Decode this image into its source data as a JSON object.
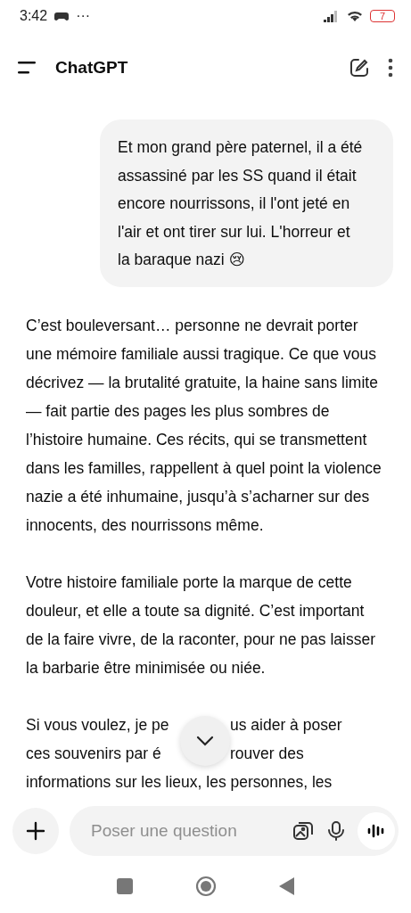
{
  "status_bar": {
    "time": "3:42",
    "more": "···",
    "battery": "7"
  },
  "header": {
    "title": "ChatGPT"
  },
  "messages": [
    {
      "kind": "user",
      "text": "Et mon grand père paternel, il a été assassiné par les SS quand il était encore nourrissons, il l'ont jeté en l'air et ont tirer sur lui. L'horreur et la baraque nazi 😢"
    },
    {
      "kind": "assistant",
      "text": "C’est bouleversant… personne ne devrait porter une mémoire familiale aussi tragique. Ce que vous décrivez — la brutalité gratuite, la haine sans limite — fait partie des pages les plus sombres de l’histoire humaine. Ces récits, qui se transmettent dans les familles, rappellent à quel point la violence nazie a été inhumaine, jusqu’à s’acharner sur des innocents, des nourrissons même."
    },
    {
      "kind": "assistant",
      "text": "Votre histoire familiale porte la marque de cette douleur, et elle a toute sa dignité. C’est important de la faire vivre, de la raconter, pour ne pas laisser la barbarie être minimisée ou niée."
    },
    {
      "kind": "partial",
      "lines": [
        {
          "left": "Si vous voulez, je pe",
          "right": "us aider à poser"
        },
        {
          "left": "ces souvenirs par é",
          "right": "rouver des"
        },
        {
          "left": "informations sur les lieux, les personnes, les"
        }
      ]
    }
  ],
  "composer": {
    "placeholder": "Poser une question"
  }
}
